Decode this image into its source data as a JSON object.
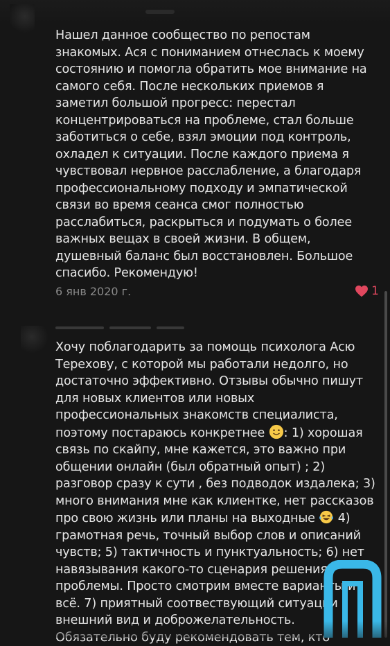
{
  "reviews": [
    {
      "text": "Нашел данное сообщество по репостам\nзнакомых. Ася с пониманием отнеслась к моему\nсостоянию и помогла обратить мое внимание на\nсамого себя. После нескольких приемов я\nзаметил большой прогресс: перестал\nконцентрироваться на проблеме, стал больше\nзаботиться о себе, взял эмоции под контроль,\nохладел к ситуации. После каждого приема я\nчувствовал нервное расслабление, а благодаря\nпрофессиональному подходу и эмпатической\nсвязи во время сеанса смог полностью\nрасслабиться, раскрыться и подумать о более\nважных вещах в своей жизни. В общем,\nдушевный баланс был восстановлен. Большое\nспасибо. Рекомендую!",
      "date": "6 янв 2020 г.",
      "likes": "1"
    },
    {
      "text_part1": "Хочу поблагодарить за помощь психолога Асю\nТерехову, с которой мы работали недолго, но\nдостаточно эффективно. Отзывы обычно пишут\nдля новых клиентов или новых\nпрофессиональных знакомств специалиста,\nпоэтому постараюсь конкретнее ",
      "text_part2": ": 1) хорошая\nсвязь по скайпу, мне кажется, это важно при\nобщении онлайн (был обратный опыт) ; 2)\nразговор сразу к сути , без подводок издалека; 3)\nмного внимания мне как клиентке, нет рассказов\nпро свою жизнь или планы на выходные ",
      "text_part3": " 4)\nграмотная речь, точный выбор слов и описаний\nчувств; 5) тактичность и пунктуальность; 6) нет\nнавязывания какого-то сценария решения\nпроблемы. Просто смотрим вместе варианты и\nвсё. 7) приятный соотвествующий ситуации\nвнешний вид и доброжелательность.\nОбязательно буду рекомендовать тем, кто"
    }
  ],
  "icons": {
    "like": "heart-icon",
    "emoji_1": "slightly-smiling-face-emoji",
    "emoji_2": "laughing-with-tears-emoji",
    "logo": "app-logo-icon"
  },
  "colors": {
    "background": "#161616",
    "text": "#e6e6e6",
    "date": "#8a8a8a",
    "like": "#e0475e",
    "logo": "#3ab8e8"
  }
}
